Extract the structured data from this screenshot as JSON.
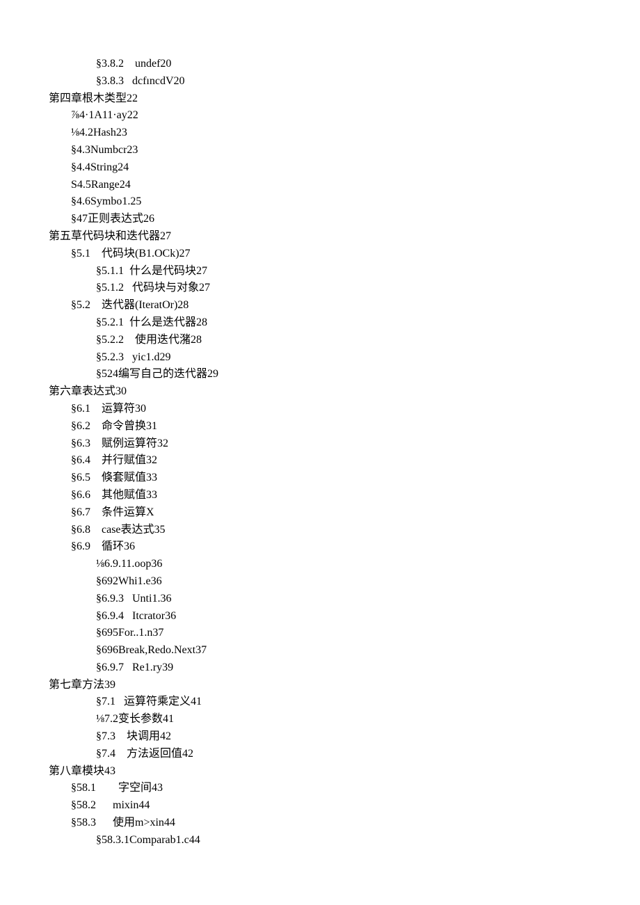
{
  "lines": [
    {
      "indent": 4,
      "text": "§3.8.2    undef20"
    },
    {
      "indent": 4,
      "text": "§3.8.3   dcfıncdV20"
    },
    {
      "indent": 0,
      "text": "第四章根木类型22"
    },
    {
      "indent": 1,
      "text": "⅞4·1A11·ay22"
    },
    {
      "indent": 1,
      "text": "⅛4.2Hash23"
    },
    {
      "indent": 1,
      "text": "§4.3Numbcr23"
    },
    {
      "indent": 1,
      "text": "§4.4String24"
    },
    {
      "indent": 1,
      "text": "S4.5Range24"
    },
    {
      "indent": 1,
      "text": "§4.6Symbo1.25"
    },
    {
      "indent": 1,
      "text": "§47正则表达式26"
    },
    {
      "indent": 0,
      "text": "第五草代码块和迭代器27"
    },
    {
      "indent": 1,
      "text": "§5.1    代码块(B1.OCk)27"
    },
    {
      "indent": 4,
      "text": "§5.1.1  什么是代码块27"
    },
    {
      "indent": 4,
      "text": "§5.1.2   代码块与对象27"
    },
    {
      "indent": 1,
      "text": "§5.2    迭代器(IteratOr)28"
    },
    {
      "indent": 4,
      "text": "§5.2.1  什么是迭代器28"
    },
    {
      "indent": 4,
      "text": "§5.2.2    使用迭代潴28"
    },
    {
      "indent": 4,
      "text": "§5.2.3   yic1.d29"
    },
    {
      "indent": 4,
      "text": "§524编写自己的迭代器29"
    },
    {
      "indent": 0,
      "text": "第六章表达式30"
    },
    {
      "indent": 1,
      "text": "§6.1    运算符30"
    },
    {
      "indent": 1,
      "text": "§6.2    命令曾换31"
    },
    {
      "indent": 1,
      "text": "§6.3    赋例运算符32"
    },
    {
      "indent": 1,
      "text": "§6.4    并行赋值32"
    },
    {
      "indent": 1,
      "text": "§6.5    倏套赋值33"
    },
    {
      "indent": 1,
      "text": "§6.6    其他赋值33"
    },
    {
      "indent": 1,
      "text": "§6.7    条件运算X"
    },
    {
      "indent": 1,
      "text": "§6.8    case表达式35"
    },
    {
      "indent": 1,
      "text": "§6.9    循环36"
    },
    {
      "indent": 4,
      "text": "⅛6.9.11.oop36"
    },
    {
      "indent": 4,
      "text": "§692Whi1.e36"
    },
    {
      "indent": 4,
      "text": "§6.9.3   Unti1.36"
    },
    {
      "indent": 4,
      "text": "§6.9.4   Itcrator36"
    },
    {
      "indent": 4,
      "text": "§695For..1.n37"
    },
    {
      "indent": 4,
      "text": "§696Break,Redo.Next37"
    },
    {
      "indent": 4,
      "text": "§6.9.7   Re1.ry39"
    },
    {
      "indent": 0,
      "text": "第七章方法39"
    },
    {
      "indent": 4,
      "text": "§7.1   运算符乘定义41"
    },
    {
      "indent": 4,
      "text": "⅛7.2变长参数41"
    },
    {
      "indent": 4,
      "text": "§7.3    块调用42"
    },
    {
      "indent": 4,
      "text": "§7.4    方法返回值42"
    },
    {
      "indent": 0,
      "text": "第八章模块43"
    },
    {
      "indent": 1,
      "text": "§58.1        字空间43"
    },
    {
      "indent": 1,
      "text": "§58.2      mixin44"
    },
    {
      "indent": 1,
      "text": "§58.3      使用m>xin44"
    },
    {
      "indent": 4,
      "text": "§58.3.1Comparab1.c44"
    }
  ]
}
